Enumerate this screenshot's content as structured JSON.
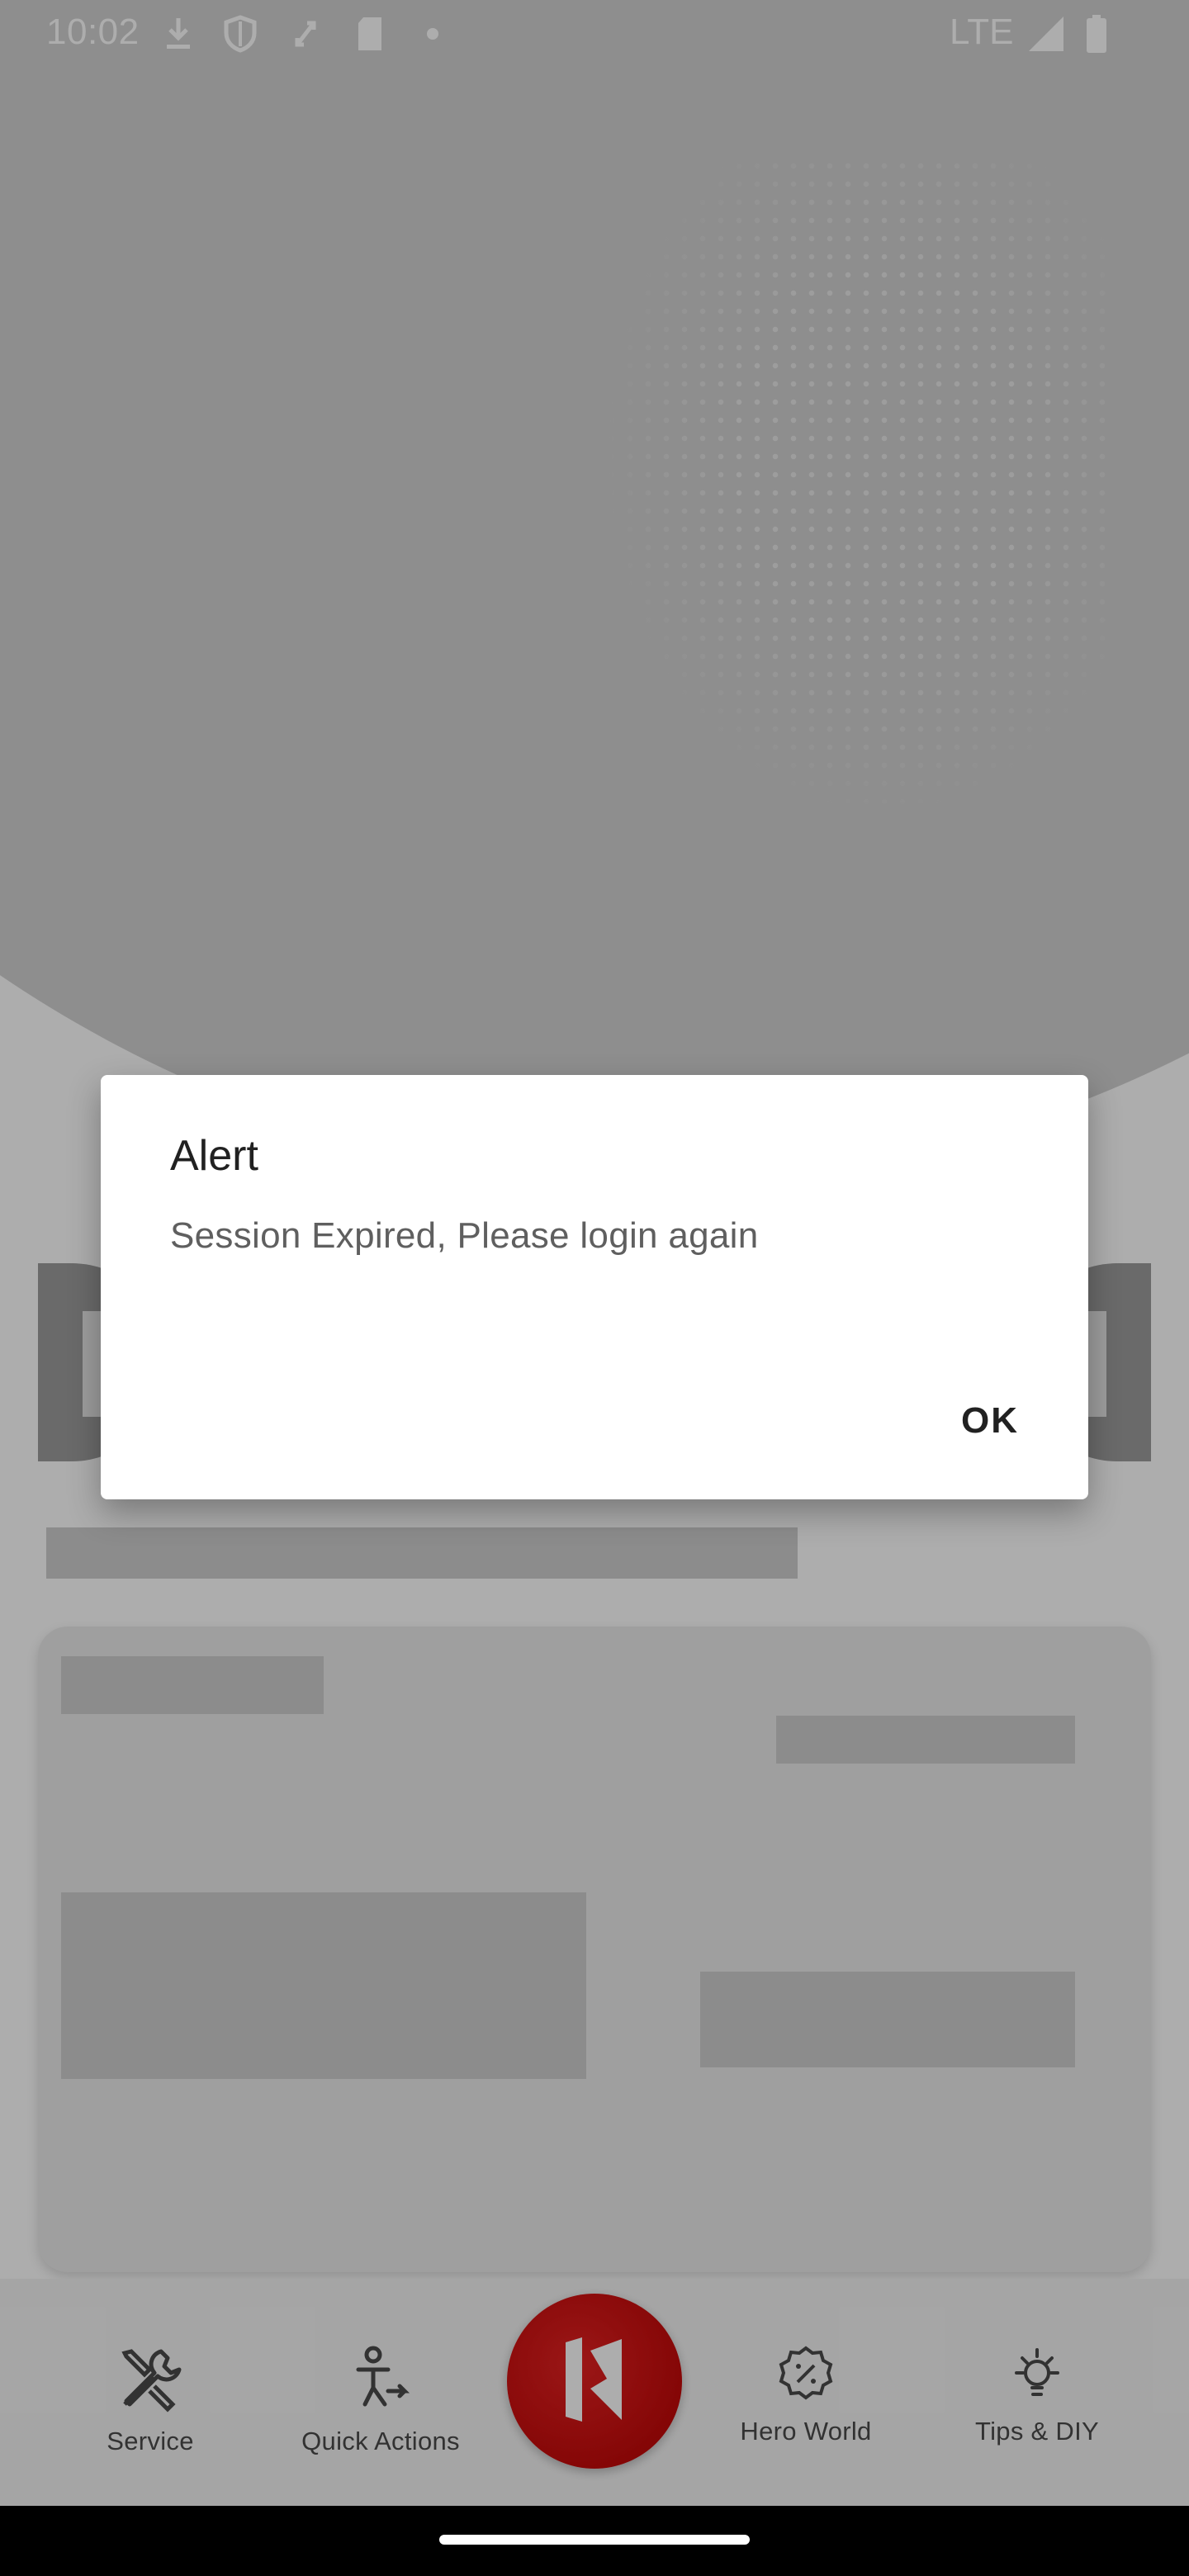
{
  "status_bar": {
    "time": "10:02",
    "network": "LTE",
    "icons": [
      "download-icon",
      "shield-icon",
      "sync-icon",
      "sd-card-icon",
      "dot-icon",
      "signal-icon",
      "battery-icon"
    ]
  },
  "bottom_nav": {
    "items": [
      {
        "label": "Service",
        "icon": "wrench-screwdriver-icon"
      },
      {
        "label": "Quick Actions",
        "icon": "rider-arrow-icon"
      },
      {
        "label": "Hero World",
        "icon": "discount-badge-icon"
      },
      {
        "label": "Tips & DIY",
        "icon": "bulb-icon"
      }
    ],
    "center_button_icon": "hero-logo-icon"
  },
  "dialog": {
    "title": "Alert",
    "message": "Session Expired, Please login again",
    "ok_label": "OK"
  },
  "colors": {
    "brand_red": "#d41010",
    "scrim": "rgba(0,0,0,0.32)"
  }
}
